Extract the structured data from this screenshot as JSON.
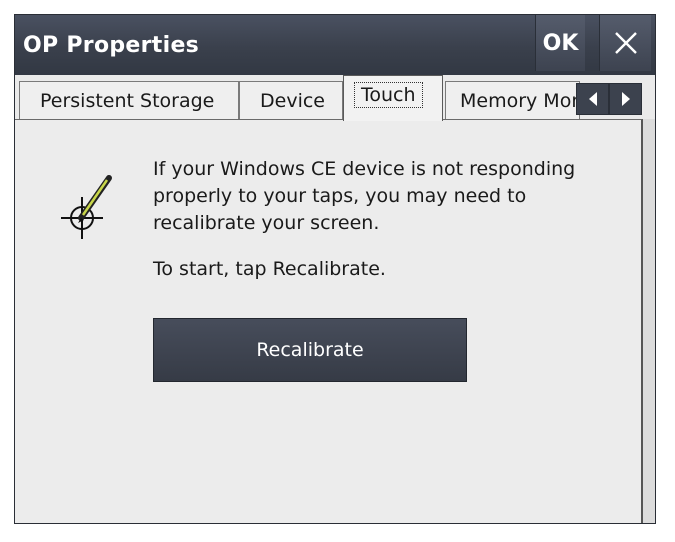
{
  "window": {
    "title": "OP Properties",
    "ok_label": "OK"
  },
  "tabs": [
    {
      "label": "Persistent Storage",
      "active": false
    },
    {
      "label": "Device",
      "active": false
    },
    {
      "label": "Touch",
      "active": true
    },
    {
      "label": "Memory Mor",
      "active": false
    }
  ],
  "touch": {
    "message": "If your Windows CE device is not responding properly to your taps, you may need to recalibrate your screen.",
    "start_text": "To start, tap Recalibrate.",
    "recalibrate_label": "Recalibrate"
  },
  "icons": {
    "close": "close-icon",
    "tab_left": "arrow-left-icon",
    "tab_right": "arrow-right-icon",
    "touch": "stylus-crosshair-icon"
  },
  "colors": {
    "titlebar": "#3a404c",
    "button": "#3f4552",
    "panel": "#ececec"
  }
}
